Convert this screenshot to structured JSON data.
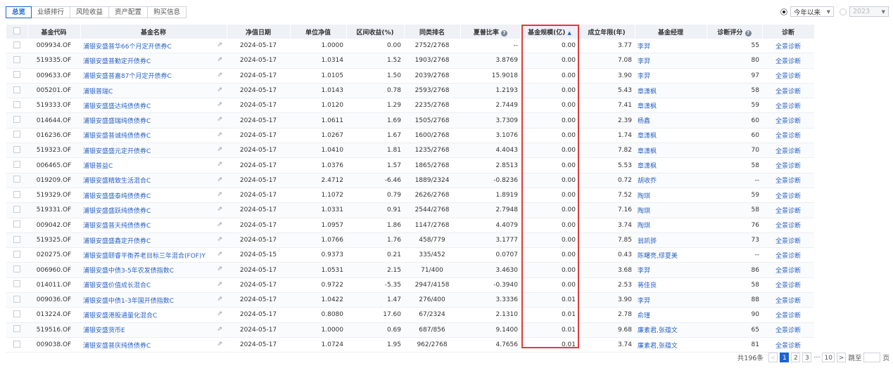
{
  "tabs": [
    "总览",
    "业绩排行",
    "风险收益",
    "资产配置",
    "购买信息"
  ],
  "filters": {
    "period_label": "今年以来",
    "year_label": "2023"
  },
  "headers": {
    "code": "基金代码",
    "name": "基金名称",
    "date": "净值日期",
    "nav": "单位净值",
    "ret": "区间收益(%)",
    "rank": "同类排名",
    "sharpe": "夏普比率",
    "scale": "基金规模(亿)",
    "years": "成立年限(年)",
    "manager": "基金经理",
    "score": "诊断评分",
    "diag": "诊断"
  },
  "sort_icon": "sort-asc-icon",
  "highlight_color": "#e03a3a",
  "rows": [
    {
      "code": "009934.OF",
      "name": "浦银安盛普华66个月定开债券C",
      "date": "2024-05-17",
      "nav": "1.0000",
      "ret": "0.00",
      "rank": "2752/2768",
      "sharpe": "--",
      "scale": "0.00",
      "years": "3.77",
      "manager": "李羿",
      "score": "55",
      "diag": "全景诊断"
    },
    {
      "code": "519335.OF",
      "name": "浦银安盛普勤定开债券C",
      "date": "2024-05-17",
      "nav": "1.0314",
      "ret": "1.52",
      "rank": "1903/2768",
      "sharpe": "3.8769",
      "scale": "0.00",
      "years": "7.08",
      "manager": "李羿",
      "score": "80",
      "diag": "全景诊断"
    },
    {
      "code": "009633.OF",
      "name": "浦银安盛普嘉87个月定开债券C",
      "date": "2024-05-17",
      "nav": "1.0105",
      "ret": "1.50",
      "rank": "2039/2768",
      "sharpe": "15.9018",
      "scale": "0.00",
      "years": "3.90",
      "manager": "李羿",
      "score": "97",
      "diag": "全景诊断"
    },
    {
      "code": "005201.OF",
      "name": "浦银普瑞C",
      "date": "2024-05-17",
      "nav": "1.0143",
      "ret": "0.78",
      "rank": "2593/2768",
      "sharpe": "1.2193",
      "scale": "0.00",
      "years": "5.43",
      "manager": "章潇枫",
      "score": "58",
      "diag": "全景诊断"
    },
    {
      "code": "519333.OF",
      "name": "浦银安盛盛达纯债债券C",
      "date": "2024-05-17",
      "nav": "1.0120",
      "ret": "1.29",
      "rank": "2235/2768",
      "sharpe": "2.7449",
      "scale": "0.00",
      "years": "7.41",
      "manager": "章潇枫",
      "score": "59",
      "diag": "全景诊断"
    },
    {
      "code": "014644.OF",
      "name": "浦银安盛盛瑞纯债债券C",
      "date": "2024-05-17",
      "nav": "1.0611",
      "ret": "1.69",
      "rank": "1505/2768",
      "sharpe": "3.7309",
      "scale": "0.00",
      "years": "2.39",
      "manager": "杨鑫",
      "score": "60",
      "diag": "全景诊断"
    },
    {
      "code": "016236.OF",
      "name": "浦银安盛普诚纯债债券C",
      "date": "2024-05-17",
      "nav": "1.0267",
      "ret": "1.67",
      "rank": "1600/2768",
      "sharpe": "3.1076",
      "scale": "0.00",
      "years": "1.74",
      "manager": "章潇枫",
      "score": "60",
      "diag": "全景诊断"
    },
    {
      "code": "519323.OF",
      "name": "浦银安盛盛元定开债券C",
      "date": "2024-05-17",
      "nav": "1.0410",
      "ret": "1.81",
      "rank": "1235/2768",
      "sharpe": "4.4043",
      "scale": "0.00",
      "years": "7.82",
      "manager": "章潇枫",
      "score": "70",
      "diag": "全景诊断"
    },
    {
      "code": "006465.OF",
      "name": "浦银普益C",
      "date": "2024-05-17",
      "nav": "1.0376",
      "ret": "1.57",
      "rank": "1865/2768",
      "sharpe": "2.8513",
      "scale": "0.00",
      "years": "5.53",
      "manager": "章潇枫",
      "score": "58",
      "diag": "全景诊断"
    },
    {
      "code": "019209.OF",
      "name": "浦银安盛精致生活混合C",
      "date": "2024-05-17",
      "nav": "2.4712",
      "ret": "-6.46",
      "rank": "1889/2324",
      "sharpe": "-0.8236",
      "scale": "0.00",
      "years": "0.72",
      "manager": "胡收乔",
      "score": "--",
      "diag": "全景诊断"
    },
    {
      "code": "519329.OF",
      "name": "浦银安盛盛泰纯债债券C",
      "date": "2024-05-17",
      "nav": "1.1072",
      "ret": "0.79",
      "rank": "2626/2768",
      "sharpe": "1.8919",
      "scale": "0.00",
      "years": "7.52",
      "manager": "陶琪",
      "score": "59",
      "diag": "全景诊断"
    },
    {
      "code": "519331.OF",
      "name": "浦银安盛盛跃纯债债券C",
      "date": "2024-05-17",
      "nav": "1.0331",
      "ret": "0.91",
      "rank": "2544/2768",
      "sharpe": "2.7948",
      "scale": "0.00",
      "years": "7.16",
      "manager": "陶琪",
      "score": "58",
      "diag": "全景诊断"
    },
    {
      "code": "009042.OF",
      "name": "浦银安盛普天纯债债券C",
      "date": "2024-05-17",
      "nav": "1.0957",
      "ret": "1.86",
      "rank": "1147/2768",
      "sharpe": "4.4079",
      "scale": "0.00",
      "years": "3.74",
      "manager": "陶琪",
      "score": "76",
      "diag": "全景诊断"
    },
    {
      "code": "519325.OF",
      "name": "浦银安盛盛鑫定开债券C",
      "date": "2024-05-17",
      "nav": "1.0766",
      "ret": "1.76",
      "rank": "458/779",
      "sharpe": "3.1777",
      "scale": "0.00",
      "years": "7.85",
      "manager": "翁凯骅",
      "score": "73",
      "diag": "全景诊断"
    },
    {
      "code": "020275.OF",
      "name": "浦银安盛颐睿平衡养老目标三年混合(FOF)Y",
      "date": "2024-05-15",
      "nav": "0.9373",
      "ret": "0.21",
      "rank": "335/452",
      "sharpe": "0.0707",
      "scale": "0.00",
      "years": "0.43",
      "manager": "陈曙亮,缪夏美",
      "score": "--",
      "diag": "全景诊断"
    },
    {
      "code": "006960.OF",
      "name": "浦银安盛中债3-5年农发债指数C",
      "date": "2024-05-17",
      "nav": "1.0531",
      "ret": "2.15",
      "rank": "71/400",
      "sharpe": "3.4630",
      "scale": "0.00",
      "years": "3.68",
      "manager": "李羿",
      "score": "86",
      "diag": "全景诊断"
    },
    {
      "code": "014011.OF",
      "name": "浦银安盛价值成长混合C",
      "date": "2024-05-17",
      "nav": "0.9722",
      "ret": "-5.35",
      "rank": "2947/4158",
      "sharpe": "-0.3940",
      "scale": "0.00",
      "years": "2.53",
      "manager": "蒋佳良",
      "score": "58",
      "diag": "全景诊断"
    },
    {
      "code": "009036.OF",
      "name": "浦银安盛中债1-3年国开债指数C",
      "date": "2024-05-17",
      "nav": "1.0422",
      "ret": "1.47",
      "rank": "276/400",
      "sharpe": "3.3336",
      "scale": "0.01",
      "years": "3.90",
      "manager": "李羿",
      "score": "88",
      "diag": "全景诊断"
    },
    {
      "code": "013224.OF",
      "name": "浦银安盛港股通量化混合C",
      "date": "2024-05-17",
      "nav": "0.8080",
      "ret": "17.60",
      "rank": "67/2324",
      "sharpe": "2.1310",
      "scale": "0.01",
      "years": "2.78",
      "manager": "俞瑾",
      "score": "90",
      "diag": "全景诊断"
    },
    {
      "code": "519516.OF",
      "name": "浦银安盛货币E",
      "date": "2024-05-17",
      "nav": "1.0000",
      "ret": "0.69",
      "rank": "687/856",
      "sharpe": "9.1400",
      "scale": "0.01",
      "years": "9.68",
      "manager": "廉素君,张蕴文",
      "score": "65",
      "diag": "全景诊断"
    },
    {
      "code": "009038.OF",
      "name": "浦银安盛普庆纯债债券C",
      "date": "2024-05-17",
      "nav": "1.0724",
      "ret": "1.95",
      "rank": "962/2768",
      "sharpe": "4.7656",
      "scale": "0.01",
      "years": "3.74",
      "manager": "廉素君,张蕴文",
      "score": "81",
      "diag": "全景诊断"
    }
  ],
  "pager": {
    "total": "共196条",
    "prev": "<",
    "pages": [
      "1",
      "2",
      "3"
    ],
    "ellipsis": "···",
    "last": "10",
    "next": ">",
    "jump_label": "跳至",
    "page_suffix": "页"
  }
}
